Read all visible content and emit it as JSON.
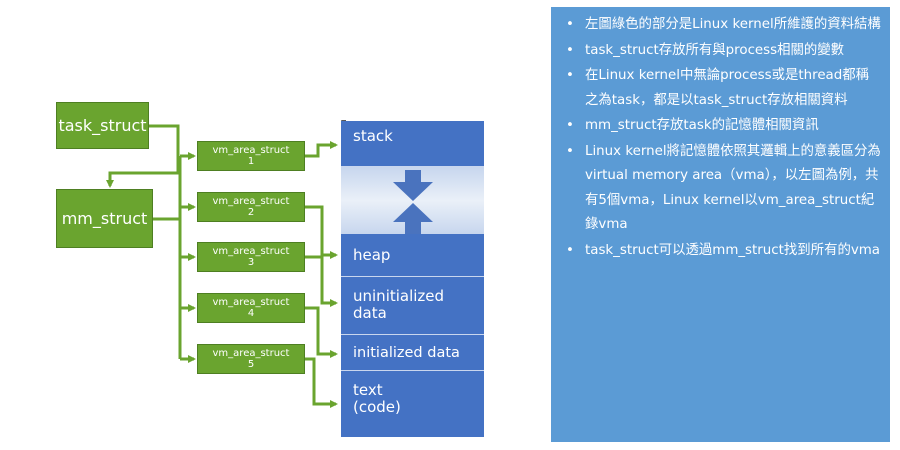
{
  "diagram": {
    "task_struct": "task_struct",
    "mm_struct": "mm_struct",
    "vm_areas": [
      {
        "label": "vm_area_struct",
        "num": "1"
      },
      {
        "label": "vm_area_struct",
        "num": "2"
      },
      {
        "label": "vm_area_struct",
        "num": "3"
      },
      {
        "label": "vm_area_struct",
        "num": "4"
      },
      {
        "label": "vm_area_struct",
        "num": "5"
      }
    ],
    "segments": {
      "stack": "stack",
      "heap": "heap",
      "uninitialized": "uninitialized data",
      "initialized": "initialized data",
      "text": "text (code)"
    }
  },
  "notes": [
    "左圖綠色的部分是Linux kernel所維護的資料結構",
    "task_struct存放所有與process相關的變數",
    "在Linux kernel中無論process或是thread都稱之為task，都是以task_struct存放相關資料",
    "mm_struct存放task的記憶體相關資訊",
    "Linux kernel將記憶體依照其邏輯上的意義區分為virtual memory area（vma），以左圖為例，共有5個vma，Linux kernel以vm_area_struct紀錄vma",
    "task_struct可以透過mm_struct找到所有的vma"
  ],
  "colors": {
    "green": "#6aa42f",
    "blue_segment": "#4472c4",
    "panel_blue": "#5b9bd5",
    "arrow_blue": "#4a73be"
  }
}
